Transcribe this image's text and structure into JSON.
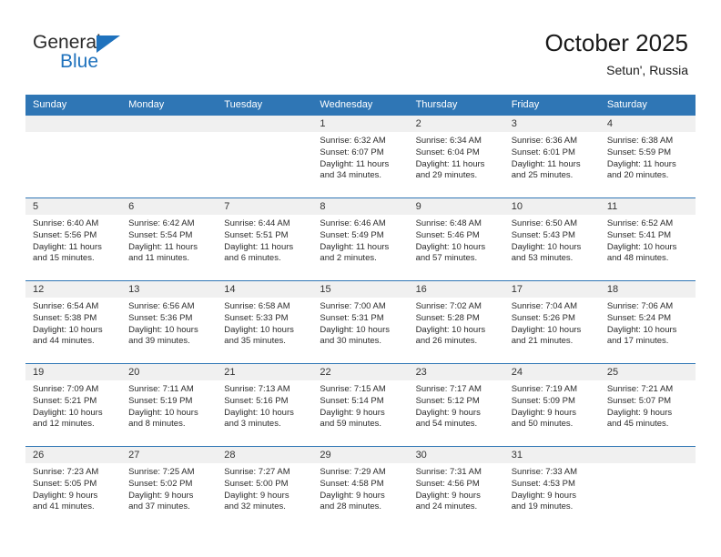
{
  "brand": {
    "name_top": "General",
    "name_bottom": "Blue",
    "triangle_color": "#1f72bd",
    "icon": "triangle-icon"
  },
  "header": {
    "title": "October 2025",
    "subtitle": "Setun', Russia",
    "accent_color": "#2f76b5",
    "band_color": "#f0f0f0"
  },
  "calendar": {
    "weekday_headers": [
      "Sunday",
      "Monday",
      "Tuesday",
      "Wednesday",
      "Thursday",
      "Friday",
      "Saturday"
    ],
    "weeks": [
      [
        {
          "day": "",
          "empty": true
        },
        {
          "day": "",
          "empty": true
        },
        {
          "day": "",
          "empty": true
        },
        {
          "day": "1",
          "sunrise": "Sunrise: 6:32 AM",
          "sunset": "Sunset: 6:07 PM",
          "daylight_line1": "Daylight: 11 hours",
          "daylight_line2": "and 34 minutes."
        },
        {
          "day": "2",
          "sunrise": "Sunrise: 6:34 AM",
          "sunset": "Sunset: 6:04 PM",
          "daylight_line1": "Daylight: 11 hours",
          "daylight_line2": "and 29 minutes."
        },
        {
          "day": "3",
          "sunrise": "Sunrise: 6:36 AM",
          "sunset": "Sunset: 6:01 PM",
          "daylight_line1": "Daylight: 11 hours",
          "daylight_line2": "and 25 minutes."
        },
        {
          "day": "4",
          "sunrise": "Sunrise: 6:38 AM",
          "sunset": "Sunset: 5:59 PM",
          "daylight_line1": "Daylight: 11 hours",
          "daylight_line2": "and 20 minutes."
        }
      ],
      [
        {
          "day": "5",
          "sunrise": "Sunrise: 6:40 AM",
          "sunset": "Sunset: 5:56 PM",
          "daylight_line1": "Daylight: 11 hours",
          "daylight_line2": "and 15 minutes."
        },
        {
          "day": "6",
          "sunrise": "Sunrise: 6:42 AM",
          "sunset": "Sunset: 5:54 PM",
          "daylight_line1": "Daylight: 11 hours",
          "daylight_line2": "and 11 minutes."
        },
        {
          "day": "7",
          "sunrise": "Sunrise: 6:44 AM",
          "sunset": "Sunset: 5:51 PM",
          "daylight_line1": "Daylight: 11 hours",
          "daylight_line2": "and 6 minutes."
        },
        {
          "day": "8",
          "sunrise": "Sunrise: 6:46 AM",
          "sunset": "Sunset: 5:49 PM",
          "daylight_line1": "Daylight: 11 hours",
          "daylight_line2": "and 2 minutes."
        },
        {
          "day": "9",
          "sunrise": "Sunrise: 6:48 AM",
          "sunset": "Sunset: 5:46 PM",
          "daylight_line1": "Daylight: 10 hours",
          "daylight_line2": "and 57 minutes."
        },
        {
          "day": "10",
          "sunrise": "Sunrise: 6:50 AM",
          "sunset": "Sunset: 5:43 PM",
          "daylight_line1": "Daylight: 10 hours",
          "daylight_line2": "and 53 minutes."
        },
        {
          "day": "11",
          "sunrise": "Sunrise: 6:52 AM",
          "sunset": "Sunset: 5:41 PM",
          "daylight_line1": "Daylight: 10 hours",
          "daylight_line2": "and 48 minutes."
        }
      ],
      [
        {
          "day": "12",
          "sunrise": "Sunrise: 6:54 AM",
          "sunset": "Sunset: 5:38 PM",
          "daylight_line1": "Daylight: 10 hours",
          "daylight_line2": "and 44 minutes."
        },
        {
          "day": "13",
          "sunrise": "Sunrise: 6:56 AM",
          "sunset": "Sunset: 5:36 PM",
          "daylight_line1": "Daylight: 10 hours",
          "daylight_line2": "and 39 minutes."
        },
        {
          "day": "14",
          "sunrise": "Sunrise: 6:58 AM",
          "sunset": "Sunset: 5:33 PM",
          "daylight_line1": "Daylight: 10 hours",
          "daylight_line2": "and 35 minutes."
        },
        {
          "day": "15",
          "sunrise": "Sunrise: 7:00 AM",
          "sunset": "Sunset: 5:31 PM",
          "daylight_line1": "Daylight: 10 hours",
          "daylight_line2": "and 30 minutes."
        },
        {
          "day": "16",
          "sunrise": "Sunrise: 7:02 AM",
          "sunset": "Sunset: 5:28 PM",
          "daylight_line1": "Daylight: 10 hours",
          "daylight_line2": "and 26 minutes."
        },
        {
          "day": "17",
          "sunrise": "Sunrise: 7:04 AM",
          "sunset": "Sunset: 5:26 PM",
          "daylight_line1": "Daylight: 10 hours",
          "daylight_line2": "and 21 minutes."
        },
        {
          "day": "18",
          "sunrise": "Sunrise: 7:06 AM",
          "sunset": "Sunset: 5:24 PM",
          "daylight_line1": "Daylight: 10 hours",
          "daylight_line2": "and 17 minutes."
        }
      ],
      [
        {
          "day": "19",
          "sunrise": "Sunrise: 7:09 AM",
          "sunset": "Sunset: 5:21 PM",
          "daylight_line1": "Daylight: 10 hours",
          "daylight_line2": "and 12 minutes."
        },
        {
          "day": "20",
          "sunrise": "Sunrise: 7:11 AM",
          "sunset": "Sunset: 5:19 PM",
          "daylight_line1": "Daylight: 10 hours",
          "daylight_line2": "and 8 minutes."
        },
        {
          "day": "21",
          "sunrise": "Sunrise: 7:13 AM",
          "sunset": "Sunset: 5:16 PM",
          "daylight_line1": "Daylight: 10 hours",
          "daylight_line2": "and 3 minutes."
        },
        {
          "day": "22",
          "sunrise": "Sunrise: 7:15 AM",
          "sunset": "Sunset: 5:14 PM",
          "daylight_line1": "Daylight: 9 hours",
          "daylight_line2": "and 59 minutes."
        },
        {
          "day": "23",
          "sunrise": "Sunrise: 7:17 AM",
          "sunset": "Sunset: 5:12 PM",
          "daylight_line1": "Daylight: 9 hours",
          "daylight_line2": "and 54 minutes."
        },
        {
          "day": "24",
          "sunrise": "Sunrise: 7:19 AM",
          "sunset": "Sunset: 5:09 PM",
          "daylight_line1": "Daylight: 9 hours",
          "daylight_line2": "and 50 minutes."
        },
        {
          "day": "25",
          "sunrise": "Sunrise: 7:21 AM",
          "sunset": "Sunset: 5:07 PM",
          "daylight_line1": "Daylight: 9 hours",
          "daylight_line2": "and 45 minutes."
        }
      ],
      [
        {
          "day": "26",
          "sunrise": "Sunrise: 7:23 AM",
          "sunset": "Sunset: 5:05 PM",
          "daylight_line1": "Daylight: 9 hours",
          "daylight_line2": "and 41 minutes."
        },
        {
          "day": "27",
          "sunrise": "Sunrise: 7:25 AM",
          "sunset": "Sunset: 5:02 PM",
          "daylight_line1": "Daylight: 9 hours",
          "daylight_line2": "and 37 minutes."
        },
        {
          "day": "28",
          "sunrise": "Sunrise: 7:27 AM",
          "sunset": "Sunset: 5:00 PM",
          "daylight_line1": "Daylight: 9 hours",
          "daylight_line2": "and 32 minutes."
        },
        {
          "day": "29",
          "sunrise": "Sunrise: 7:29 AM",
          "sunset": "Sunset: 4:58 PM",
          "daylight_line1": "Daylight: 9 hours",
          "daylight_line2": "and 28 minutes."
        },
        {
          "day": "30",
          "sunrise": "Sunrise: 7:31 AM",
          "sunset": "Sunset: 4:56 PM",
          "daylight_line1": "Daylight: 9 hours",
          "daylight_line2": "and 24 minutes."
        },
        {
          "day": "31",
          "sunrise": "Sunrise: 7:33 AM",
          "sunset": "Sunset: 4:53 PM",
          "daylight_line1": "Daylight: 9 hours",
          "daylight_line2": "and 19 minutes."
        },
        {
          "day": "",
          "empty": true
        }
      ]
    ]
  }
}
